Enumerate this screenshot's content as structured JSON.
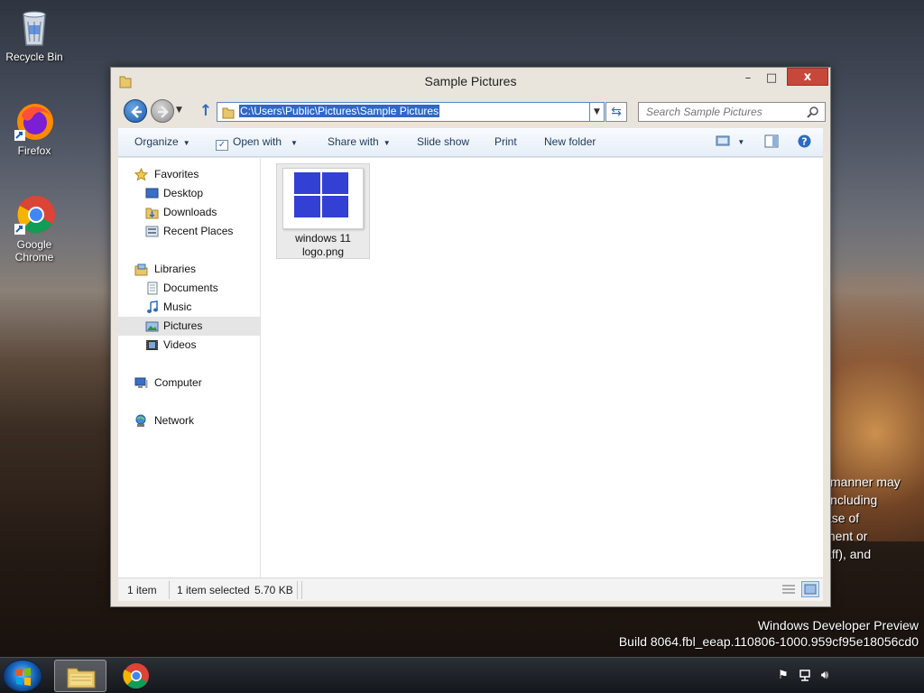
{
  "desktop": {
    "icons": [
      {
        "label": "Recycle Bin"
      },
      {
        "label": "Firefox"
      },
      {
        "label": "Google Chrome"
      }
    ],
    "overlay_text": [
      "manner may",
      "including",
      "ase of",
      "ment or",
      "aff), and"
    ],
    "watermark": {
      "line1": "Windows Developer Preview",
      "line2": "Build 8064.fbl_eeap.110806-1000.959cf95e18056cd0"
    }
  },
  "window": {
    "title": "Sample Pictures",
    "controls": {
      "minimize": "–",
      "maximize": "□",
      "close": "x"
    },
    "address": {
      "value": "C:\\Users\\Public\\Pictures\\Sample Pictures"
    },
    "search": {
      "placeholder": "Search Sample Pictures"
    },
    "toolbar": {
      "organize": "Organize",
      "open_with": "Open with",
      "share_with": "Share with",
      "slide_show": "Slide show",
      "print": "Print",
      "new_folder": "New folder"
    },
    "nav": {
      "favorites": "Favorites",
      "desktop": "Desktop",
      "downloads": "Downloads",
      "recent_places": "Recent Places",
      "libraries": "Libraries",
      "documents": "Documents",
      "music": "Music",
      "pictures": "Pictures",
      "videos": "Videos",
      "computer": "Computer",
      "network": "Network",
      "selected": "Pictures"
    },
    "files": [
      {
        "name_line1": "windows 11",
        "name_line2": "logo.png"
      }
    ],
    "status": {
      "count": "1 item",
      "selection": "1 item selected",
      "size": "5.70 KB"
    }
  },
  "colors": {
    "accent": "#3068c6",
    "close_button": "#c7483a",
    "logo_blue": "#3240d4"
  }
}
